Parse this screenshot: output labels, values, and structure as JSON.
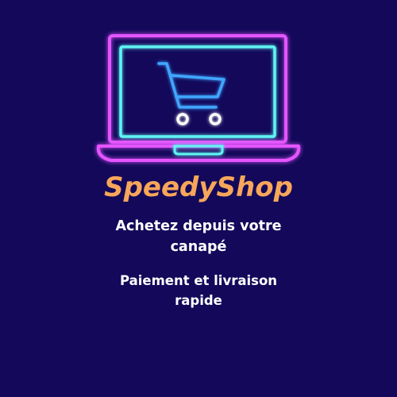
{
  "brand": {
    "name": "SpeedyShop",
    "color": "#f7a65a"
  },
  "taglines": {
    "line1a": "Achetez depuis votre",
    "line1b": "canapé",
    "line2a": "Paiement et livraison",
    "line2b": "rapide"
  },
  "colors": {
    "background": "#13085a",
    "laptop_outline": "#e455ff",
    "screen_outline": "#5ff4f4",
    "cart_outline": "#3fa6ff",
    "text": "#ffffff"
  },
  "icons": {
    "laptop": "laptop-icon",
    "cart": "shopping-cart-icon"
  }
}
